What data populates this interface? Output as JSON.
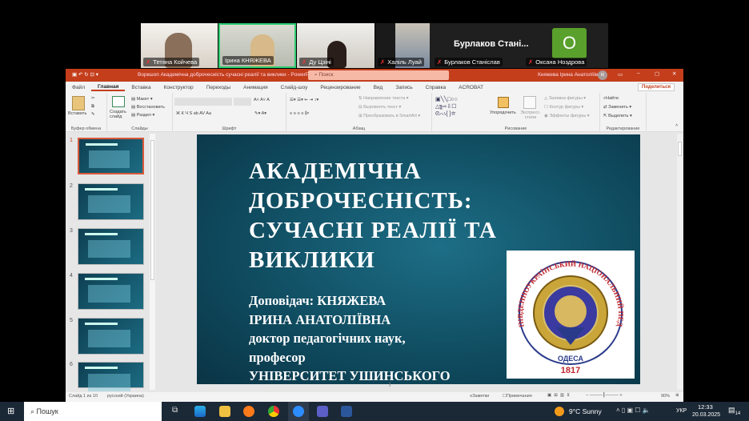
{
  "meeting": {
    "participants": [
      {
        "name": "Тетяна Койчева",
        "muted": true
      },
      {
        "name": "Ірина КНЯЖЕВА",
        "muted": false,
        "speaking": true
      },
      {
        "name": "Ду Цзіні",
        "muted": true
      },
      {
        "name": "Халіль Луай",
        "muted": true
      },
      {
        "name": "Бурлаков Станіслав",
        "muted": true,
        "display": "Бурлаков Стані..."
      },
      {
        "name": "Оксана Ноздрова",
        "muted": true,
        "initial": "О"
      }
    ]
  },
  "window": {
    "title": "Воркшоп Академічна доброчесність сучасні реалії та виклики - PowerPoint",
    "search_placeholder": "Поиск",
    "user": "Княжева Ірина Анатоліївна",
    "user_initials": "ІК",
    "share": "Поделиться"
  },
  "tabs": [
    "Файл",
    "Главная",
    "Вставка",
    "Конструктор",
    "Переходы",
    "Анимация",
    "Слайд-шоу",
    "Рецензирование",
    "Вид",
    "Запись",
    "Справка",
    "ACROBAT"
  ],
  "ribbon": {
    "clipboard": {
      "label": "Буфер обмена",
      "paste": "Вставить"
    },
    "slides": {
      "label": "Слайды",
      "new": "Создать слайд",
      "layout": "Макет",
      "reset": "Восстановить",
      "section": "Раздел"
    },
    "font": {
      "label": "Шрифт",
      "buttons": "Ж К Ч S ab AV Aa"
    },
    "paragraph": {
      "label": "Абзац",
      "dir": "Направление текста",
      "align": "Выровнять текст",
      "smartart": "Преобразовать в SmartArt"
    },
    "drawing": {
      "label": "Рисование",
      "arrange": "Упорядочить",
      "styles": "Экспресс-стили",
      "fill": "Заливка фигуры",
      "outline": "Контур фигуры",
      "effects": "Эффекты фигуры"
    },
    "editing": {
      "label": "Редактирование",
      "find": "Найти",
      "replace": "Заменить",
      "select": "Выделить"
    }
  },
  "thumbnails": [
    "1",
    "2",
    "3",
    "4",
    "5",
    "6"
  ],
  "slide": {
    "title_lines": [
      "АКАДЕМІЧНА",
      "ДОБРОЧЕСНІСТЬ:",
      "СУЧАСНІ РЕАЛІЇ ТА",
      "ВИКЛИКИ"
    ],
    "subtitle_lines": [
      "Доповідач: КНЯЖЕВА",
      "ІРИНА АНАТОЛІЇВНА",
      "доктор педагогічних наук,",
      "професор",
      "УНІВЕРСИТЕТ УШИНСЬКОГО"
    ],
    "logo_text": "ПІВДЕННОУКРАЇНСЬКИЙ НАЦІОНАЛЬНИЙ ПЕДАГОГІЧНИЙ УНІВЕРСИТЕТ ІМЕНІ К.Д. УШИНСЬКОГО · ОДЕСА 1817"
  },
  "status": {
    "slide": "Слайд 1 из 10",
    "lang": "русский (Украина)",
    "notes": "Заметки",
    "comments": "Примечания",
    "zoom": "90%"
  },
  "taskbar": {
    "search": "Пошук",
    "weather": "9°C  Sunny",
    "lang": "УКР",
    "time": "12:33",
    "date": "20.03.2025",
    "notif": "14"
  }
}
